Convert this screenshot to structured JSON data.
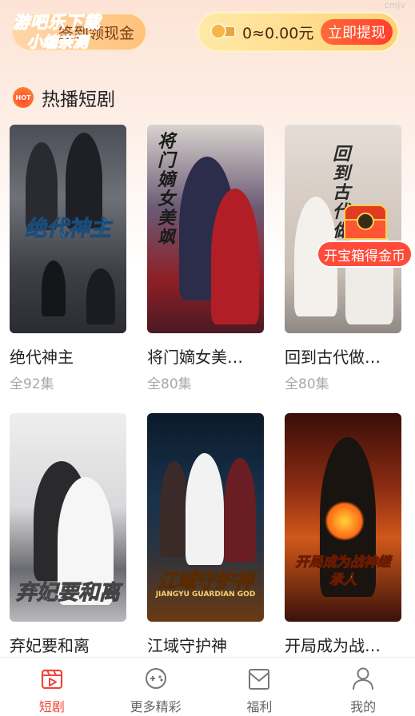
{
  "header": {
    "logo_line1": "游吧乐下载",
    "logo_line2": "小编亲测",
    "signin_label": "签到领现金",
    "balance_label": "0≈0.00元",
    "withdraw_label": "立即提现",
    "corner_mark": "cmjv",
    "accent_color": "#ff4a2a"
  },
  "section": {
    "hot_badge": "HOT",
    "title": "热播短剧"
  },
  "dramas": [
    {
      "title": "绝代神主",
      "episodes": "全92集",
      "poster_text": "绝代神主"
    },
    {
      "title": "将门嫡女美…",
      "episodes": "全80集",
      "poster_text": "将门嫡女美飒"
    },
    {
      "title": "回到古代做…",
      "episodes": "全80集",
      "poster_text": "回到古代做"
    },
    {
      "title": "弃妃要和离",
      "episodes": "",
      "poster_text": "弃妃要和离"
    },
    {
      "title": "江域守护神",
      "episodes": "",
      "poster_text": "江域守护神",
      "poster_sub": "JIANGYU GUARDIAN GOD"
    },
    {
      "title": "开局成为战…",
      "episodes": "",
      "poster_text": "开局成为战神继承人"
    }
  ],
  "treasure": {
    "badge": "开宝箱得金币"
  },
  "tabbar": {
    "items": [
      {
        "label": "短剧",
        "icon": "clapperboard-icon",
        "active": true
      },
      {
        "label": "更多精彩",
        "icon": "gamepad-icon",
        "active": false
      },
      {
        "label": "福利",
        "icon": "envelope-icon",
        "active": false
      },
      {
        "label": "我的",
        "icon": "user-icon",
        "active": false
      }
    ],
    "active_color": "#f0463a"
  }
}
